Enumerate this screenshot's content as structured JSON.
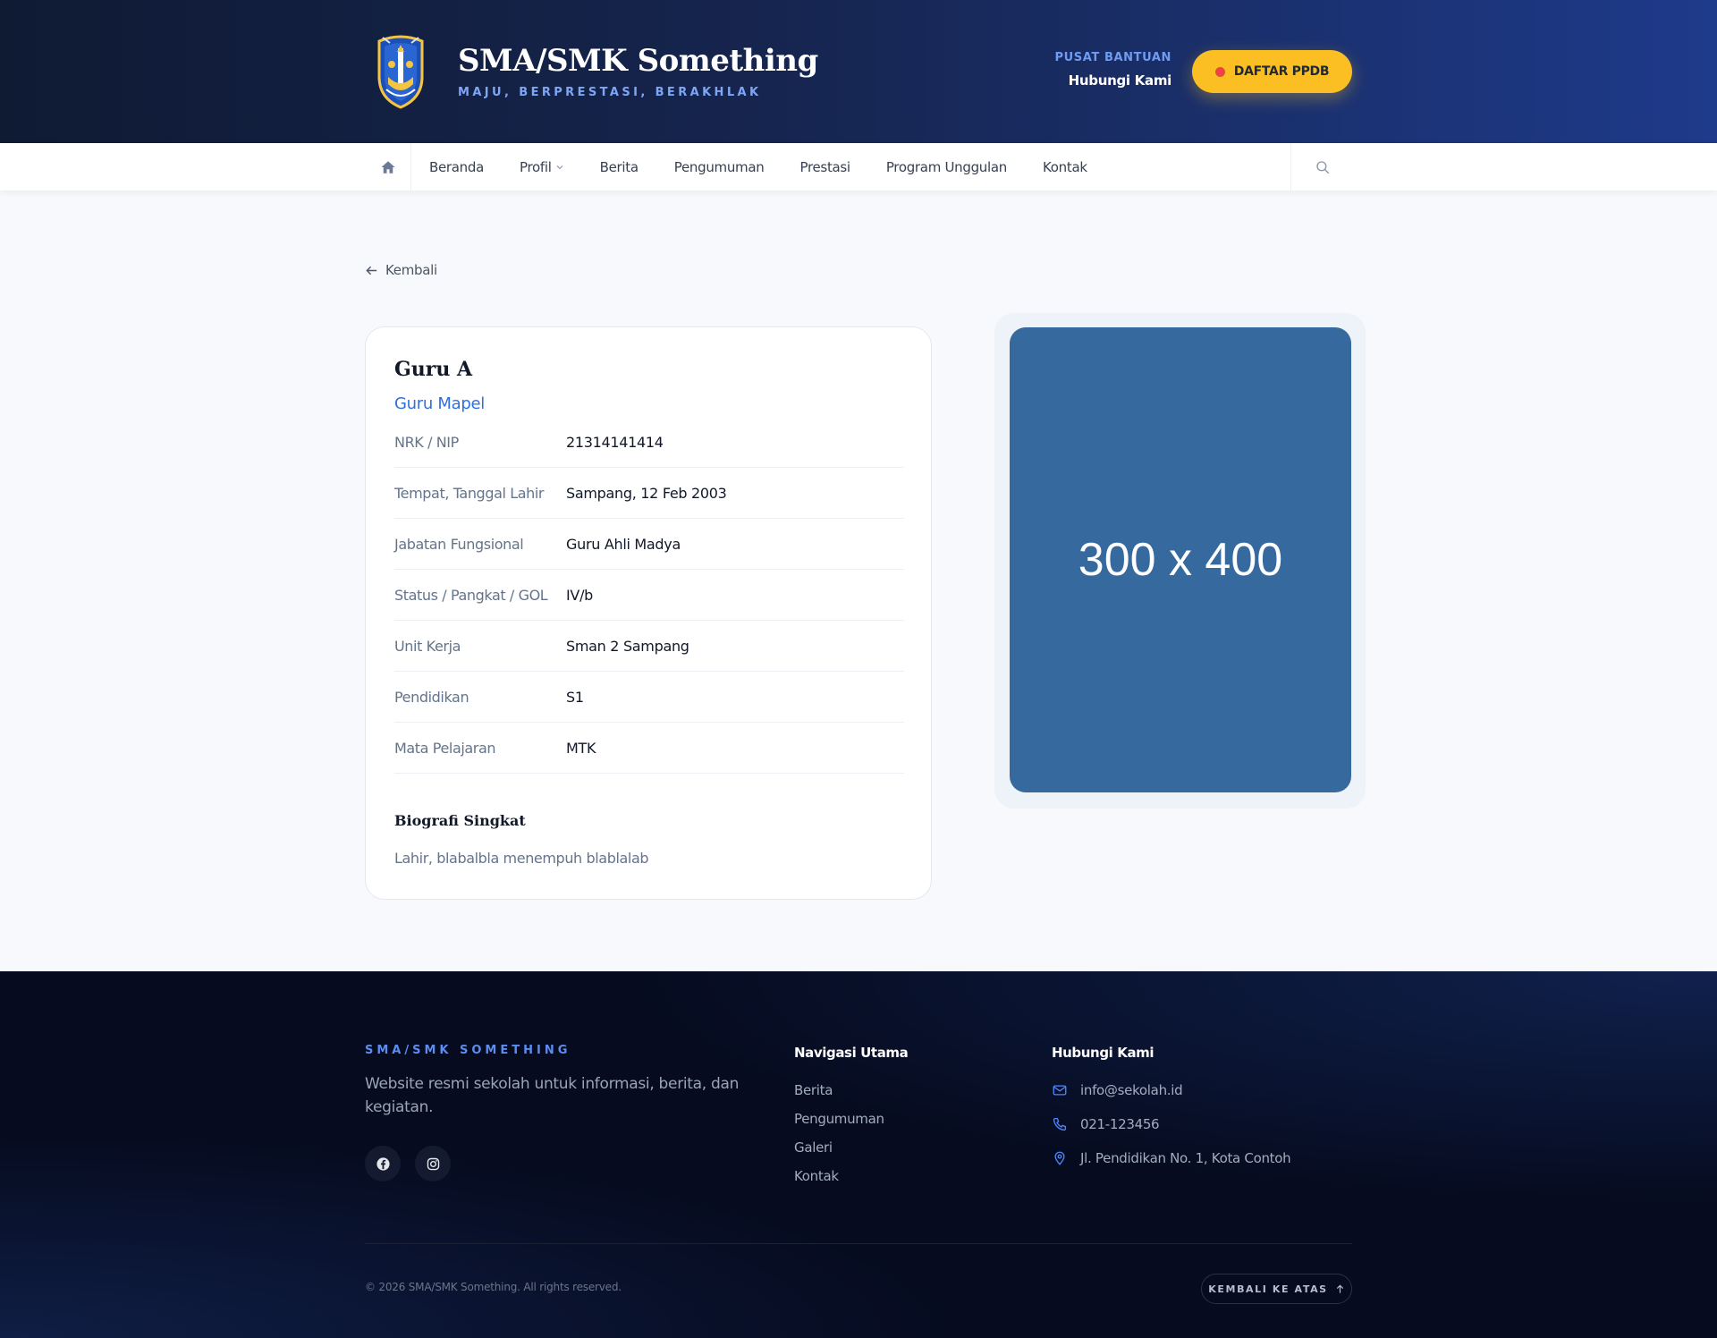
{
  "header": {
    "site_title": "SMA/SMK Something",
    "tagline": "MAJU, BERPRESTASI, BERAKHLAK",
    "help_label": "PUSAT BANTUAN",
    "help_link": "Hubungi Kami",
    "ppdb_button": "DAFTAR PPDB",
    "logo_icon": "school-crest-icon"
  },
  "nav": {
    "home_icon": "home-icon",
    "items": [
      {
        "label": "Beranda"
      },
      {
        "label": "Profil",
        "has_dropdown": true
      },
      {
        "label": "Berita"
      },
      {
        "label": "Pengumuman"
      },
      {
        "label": "Prestasi"
      },
      {
        "label": "Program Unggulan"
      },
      {
        "label": "Kontak"
      }
    ],
    "search_icon": "search-icon"
  },
  "main": {
    "back_label": "Kembali",
    "teacher": {
      "name": "Guru A",
      "role": "Guru Mapel",
      "fields": [
        {
          "label": "NRK / NIP",
          "value": "21314141414"
        },
        {
          "label": "Tempat, Tanggal Lahir",
          "value": "Sampang, 12 Feb 2003"
        },
        {
          "label": "Jabatan Fungsional",
          "value": "Guru Ahli Madya"
        },
        {
          "label": "Status / Pangkat / GOL",
          "value": "IV/b"
        },
        {
          "label": "Unit Kerja",
          "value": "Sman 2 Sampang"
        },
        {
          "label": "Pendidikan",
          "value": "S1"
        },
        {
          "label": "Mata Pelajaran",
          "value": "MTK"
        }
      ],
      "bio_title": "Biografi Singkat",
      "bio_text": "Lahir, blabalbla menempuh blablalab"
    },
    "photo_placeholder": "300 x 400"
  },
  "footer": {
    "brand": "SMA/SMK SOMETHING",
    "description": "Website resmi sekolah untuk informasi, berita, dan kegiatan.",
    "social": [
      {
        "icon": "facebook-icon"
      },
      {
        "icon": "instagram-icon"
      }
    ],
    "nav_title": "Navigasi Utama",
    "nav_links": [
      {
        "label": "Berita"
      },
      {
        "label": "Pengumuman"
      },
      {
        "label": "Galeri"
      },
      {
        "label": "Kontak"
      }
    ],
    "contact_title": "Hubungi Kami",
    "contacts": [
      {
        "icon": "mail-icon",
        "text": "info@sekolah.id"
      },
      {
        "icon": "phone-icon",
        "text": "021-123456"
      },
      {
        "icon": "location-pin-icon",
        "text": "Jl. Pendidikan No. 1, Kota Contoh"
      }
    ],
    "copyright": "© 2026 SMA/SMK Something. All rights reserved.",
    "back_to_top": "KEMBALI KE ATAS"
  },
  "colors": {
    "accent_blue": "#2f6fe0",
    "ppdb_yellow": "#fbbf24",
    "photo_bg": "#36699e"
  }
}
